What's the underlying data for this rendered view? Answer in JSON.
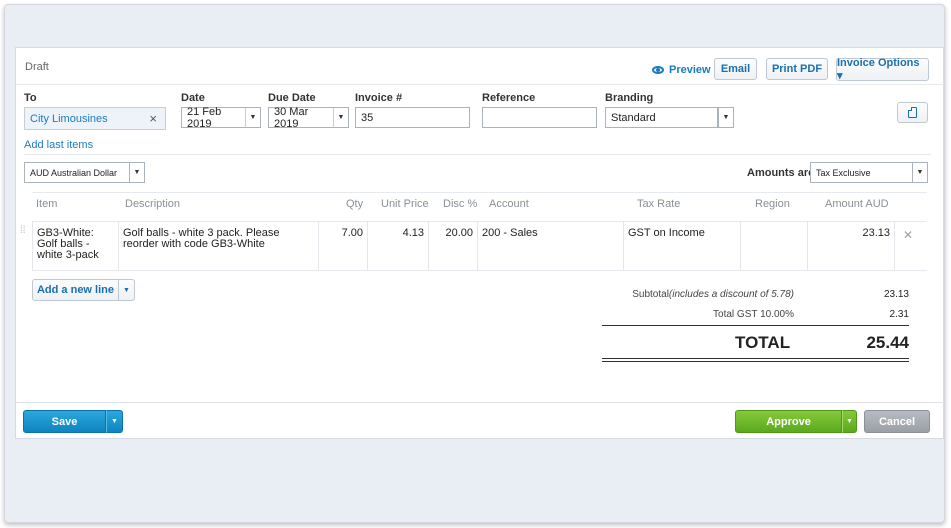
{
  "header": {
    "status": "Draft",
    "preview_label": "Preview",
    "email_label": "Email",
    "print_pdf_label": "Print PDF",
    "invoice_options_label": "Invoice Options ▾"
  },
  "fields": {
    "to_label": "To",
    "to_value": "City Limousines",
    "to_clear": "×",
    "date_label": "Date",
    "date_value": "21 Feb 2019",
    "due_label": "Due Date",
    "due_value": "30 Mar 2019",
    "invoice_label": "Invoice #",
    "invoice_value": "35",
    "reference_label": "Reference",
    "reference_value": "",
    "branding_label": "Branding",
    "branding_value": "Standard",
    "add_last_items": "Add last items",
    "currency_value": "AUD Australian Dollar",
    "amounts_are_label": "Amounts are",
    "amounts_are_value": "Tax Exclusive"
  },
  "table": {
    "headers": {
      "item": "Item",
      "description": "Description",
      "qty": "Qty",
      "unit_price": "Unit Price",
      "disc": "Disc %",
      "account": "Account",
      "tax_rate": "Tax Rate",
      "region": "Region",
      "amount": "Amount AUD"
    },
    "rows": [
      {
        "item": "GB3-White: Golf balls - white 3-pack",
        "description": "Golf balls - white 3 pack. Please reorder with code GB3-White",
        "qty": "7.00",
        "unit_price": "4.13",
        "disc": "20.00",
        "account": "200 - Sales",
        "tax_rate": "GST on Income",
        "region": "",
        "amount": "23.13",
        "delete": "✕"
      }
    ],
    "add_line_label": "Add a new line"
  },
  "totals": {
    "subtotal_label": "Subtotal",
    "subtotal_note": "(includes a discount of 5.78)",
    "subtotal_value": "23.13",
    "gst_label": "Total GST 10.00%",
    "gst_value": "2.31",
    "total_label": "TOTAL",
    "total_value": "25.44"
  },
  "footer": {
    "save_label": "Save",
    "approve_label": "Approve",
    "cancel_label": "Cancel"
  },
  "colors": {
    "save": "#1a8fcb",
    "approve": "#6cb82a",
    "link": "#1a7bbf"
  },
  "icons": {
    "preview": "eye-icon",
    "page_layout": "page-icon",
    "drag": "drag-handle-icon",
    "delete": "close-icon",
    "dropdown": "caret-down-icon"
  }
}
